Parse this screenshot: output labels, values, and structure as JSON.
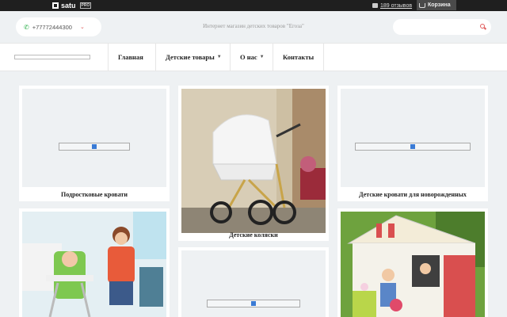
{
  "topbar": {
    "brand": "satu",
    "badge": "PRO",
    "reviews": "189 отзывов",
    "cart": "Корзина"
  },
  "header": {
    "phone": "+77772444300",
    "shop_name": "Интернет магазин детских товаров \"Егоза\"",
    "search_placeholder": ""
  },
  "nav": {
    "items": [
      {
        "label": "Главная",
        "has_dropdown": false
      },
      {
        "label": "Детские товары",
        "has_dropdown": true
      },
      {
        "label": "О нас",
        "has_dropdown": true
      },
      {
        "label": "Контакты",
        "has_dropdown": false
      }
    ]
  },
  "categories": [
    {
      "title": "Подростковые кровати",
      "image": "broken"
    },
    {
      "title": "Детские коляски",
      "image": "stroller"
    },
    {
      "title": "Детские кровати для новорожденных",
      "image": "broken"
    },
    {
      "title": "",
      "image": "highchair"
    },
    {
      "title": "",
      "image": "broken"
    },
    {
      "title": "",
      "image": "playhouse"
    }
  ],
  "colors": {
    "accent": "#e05c5c",
    "phone_icon": "#2bb04a",
    "topbar": "#1f1f1f",
    "background": "#eef1f3"
  },
  "icons": [
    "satu-logo-icon",
    "speech-bubble-icon",
    "cart-icon",
    "phone-icon",
    "chevron-down-icon",
    "search-icon",
    "broken-image-icon"
  ]
}
